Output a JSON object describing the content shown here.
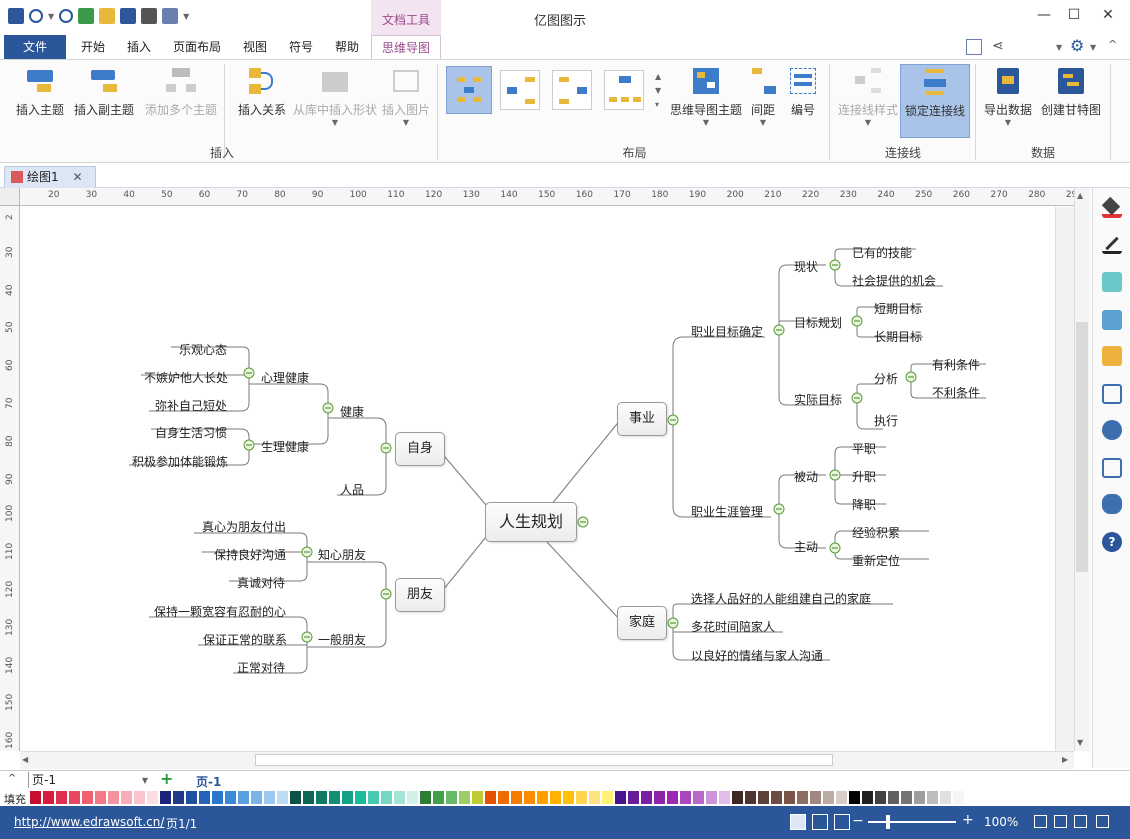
{
  "window": {
    "title": "亿图图示",
    "context_tab_group": "文档工具"
  },
  "tabs": [
    "文件",
    "开始",
    "插入",
    "页面布局",
    "视图",
    "符号",
    "帮助",
    "思维导图"
  ],
  "ribbon": {
    "insert_group": {
      "label": "插入",
      "buttons": [
        "插入主题",
        "插入副主题",
        "添加多个主题",
        "插入关系",
        "从库中插入形状",
        "插入图片"
      ]
    },
    "layout_group": {
      "label": "布局",
      "buttons": [
        "思维导图主题",
        "间距",
        "编号"
      ]
    },
    "connector_group": {
      "label": "连接线",
      "buttons": [
        "连接线样式",
        "锁定连接线"
      ]
    },
    "data_group": {
      "label": "数据",
      "buttons": [
        "导出数据",
        "创建甘特图"
      ]
    }
  },
  "document_tab": "绘图1",
  "ruler": {
    "h": [
      "20",
      "30",
      "40",
      "50",
      "60",
      "70",
      "80",
      "90",
      "100",
      "110",
      "120",
      "130",
      "140",
      "150",
      "160",
      "170",
      "180",
      "190",
      "200",
      "210",
      "220",
      "230",
      "240",
      "250",
      "260",
      "270",
      "280",
      "29"
    ],
    "v": [
      "2",
      "30",
      "40",
      "50",
      "60",
      "70",
      "80",
      "90",
      "100",
      "110",
      "120",
      "130",
      "140",
      "150",
      "160"
    ]
  },
  "mindmap": {
    "root": "人生规划",
    "main": {
      "career": "事业",
      "self": "自身",
      "friends": "朋友",
      "family": "家庭"
    },
    "career": {
      "goal": "职业目标确定",
      "status": "现状",
      "status_items": [
        "已有的技能",
        "社会提供的机会"
      ],
      "plan": "目标规划",
      "plan_items": [
        "短期目标",
        "长期目标"
      ],
      "actual": "实际目标",
      "analysis": "分析",
      "analysis_items": [
        "有利条件",
        "不利条件"
      ],
      "execute": "执行",
      "manage": "职业生涯管理",
      "passive": "被动",
      "passive_items": [
        "平职",
        "升职",
        "降职"
      ],
      "active": "主动",
      "active_items": [
        "经验积累",
        "重新定位"
      ]
    },
    "self": {
      "health": "健康",
      "mental": "心理健康",
      "mental_items": [
        "乐观心态",
        "不嫉妒他人长处",
        "弥补自己短处"
      ],
      "physical": "生理健康",
      "physical_items": [
        "自身生活习惯",
        "积极参加体能锻炼"
      ],
      "character": "人品"
    },
    "friends": {
      "close": "知心朋友",
      "close_items": [
        "真心为朋友付出",
        "保持良好沟通",
        "真诚对待"
      ],
      "normal": "一般朋友",
      "normal_items": [
        "保持一颗宽容有忍耐的心",
        "保证正常的联系",
        "正常对待"
      ]
    },
    "family": {
      "items": [
        "选择人品好的人能组建自己的家庭",
        "多花时间陪家人",
        "以良好的情绪与家人沟通"
      ]
    }
  },
  "pagebar": {
    "page_select": "页-1",
    "active_page": "页-1"
  },
  "palette": {
    "label": "填充"
  },
  "status": {
    "url": "http://www.edrawsoft.cn/",
    "page_info": "页1/1",
    "zoom": "100%"
  }
}
